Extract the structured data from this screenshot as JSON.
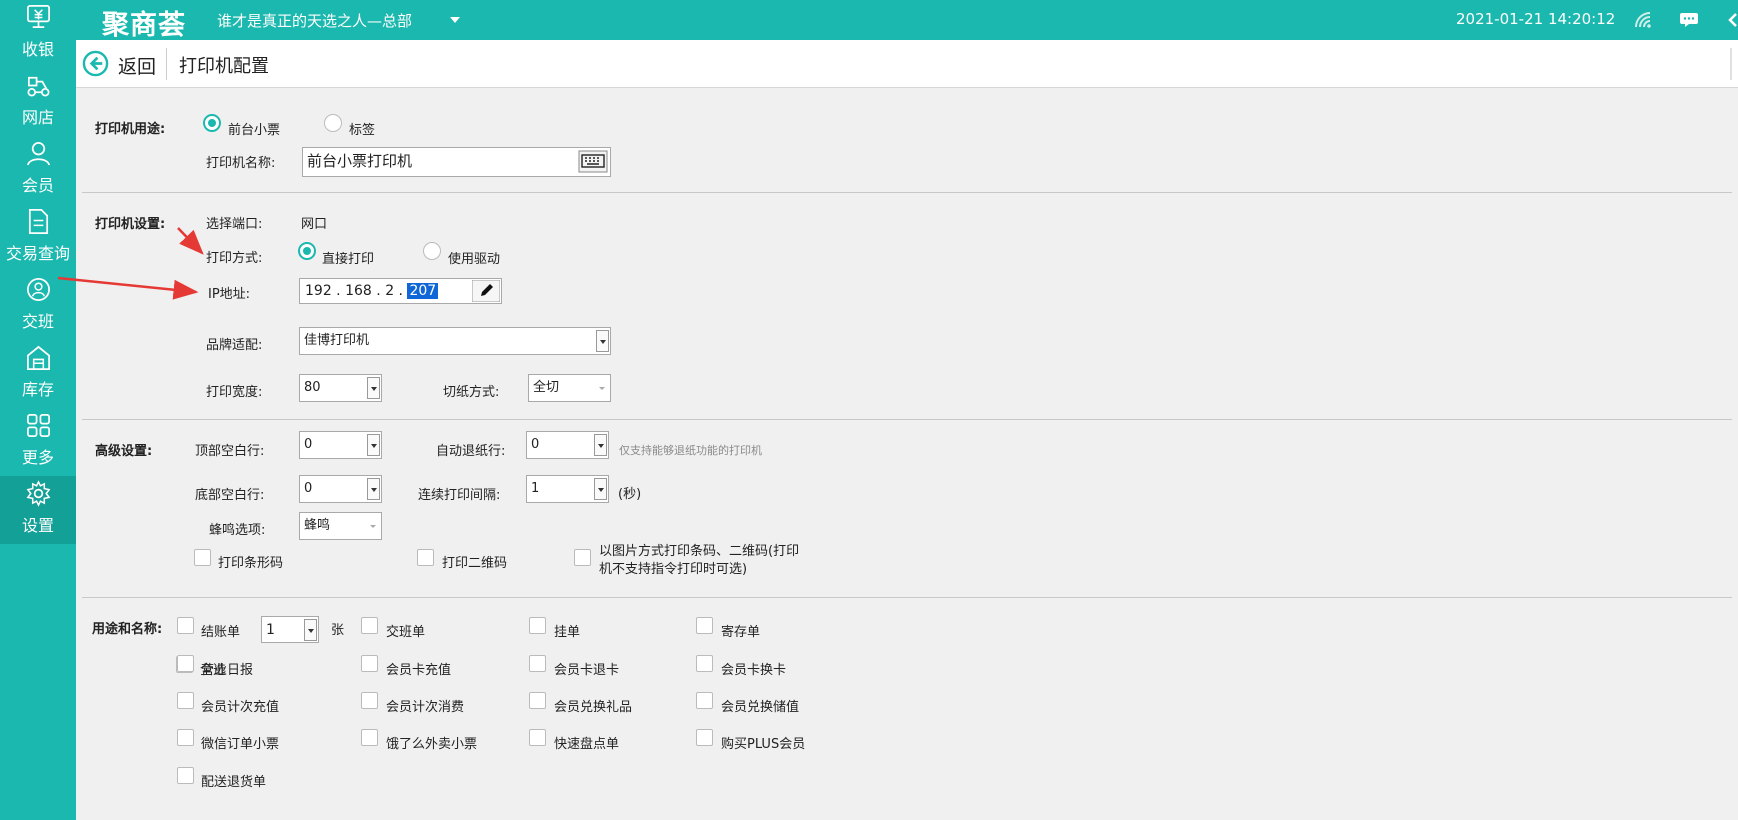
{
  "topbar": {
    "logo": "聚商荟",
    "store": "谁才是真正的天选之人—总部",
    "datetime": "2021-01-21 14:20:12"
  },
  "sidebar": {
    "items": [
      {
        "label": "收银",
        "icon": "cashier-icon",
        "active": false
      },
      {
        "label": "网店",
        "icon": "delivery-icon",
        "active": false
      },
      {
        "label": "会员",
        "icon": "member-icon",
        "active": false
      },
      {
        "label": "交易查询",
        "icon": "document-icon",
        "active": false
      },
      {
        "label": "交班",
        "icon": "handover-icon",
        "active": false
      },
      {
        "label": "库存",
        "icon": "warehouse-icon",
        "active": false
      },
      {
        "label": "更多",
        "icon": "grid-icon",
        "active": false
      },
      {
        "label": "设置",
        "icon": "gear-icon",
        "active": true
      }
    ]
  },
  "header": {
    "back": "返回",
    "title": "打印机配置"
  },
  "usage": {
    "label": "打印机用途:",
    "options": [
      "前台小票",
      "标签"
    ],
    "selected": "前台小票",
    "name_label": "打印机名称:",
    "name_value": "前台小票打印机"
  },
  "settings": {
    "label": "打印机设置:",
    "port_label": "选择端口:",
    "port_value": "网口",
    "mode_label": "打印方式:",
    "mode_options": [
      "直接打印",
      "使用驱动"
    ],
    "mode_selected": "直接打印",
    "ip_label": "IP地址:",
    "ip_parts": [
      "192",
      "168",
      "2",
      "207"
    ],
    "brand_label": "品牌适配:",
    "brand_value": "佳博打印机",
    "width_label": "打印宽度:",
    "width_value": "80",
    "cut_label": "切纸方式:",
    "cut_value": "全切"
  },
  "advanced": {
    "label": "高级设置:",
    "top_label": "顶部空白行:",
    "top_value": "0",
    "auto_label": "自动退纸行:",
    "auto_value": "0",
    "auto_hint": "仅支持能够退纸功能的打印机",
    "bottom_label": "底部空白行:",
    "bottom_value": "0",
    "interval_label": "连续打印间隔:",
    "interval_value": "1",
    "interval_unit": "(秒)",
    "beep_label": "蜂鸣选项:",
    "beep_value": "蜂鸣",
    "barcode": "打印条形码",
    "qrcode": "打印二维码",
    "image_mode_1": "以图片方式打印条码、二维码(打印",
    "image_mode_2": "机不支持指令打印时可选)"
  },
  "purposes": {
    "label": "用途和名称:",
    "select_all": "全选",
    "checkout": "结账单",
    "checkout_count": "1",
    "unit": "张",
    "items": [
      "交班单",
      "挂单",
      "寄存单",
      "营业日报",
      "会员卡充值",
      "会员卡退卡",
      "会员卡换卡",
      "会员计次充值",
      "会员计次消费",
      "会员兑换礼品",
      "会员兑换储值",
      "微信订单小票",
      "饿了么外卖小票",
      "快速盘点单",
      "购买PLUS会员",
      "配送退货单"
    ]
  }
}
